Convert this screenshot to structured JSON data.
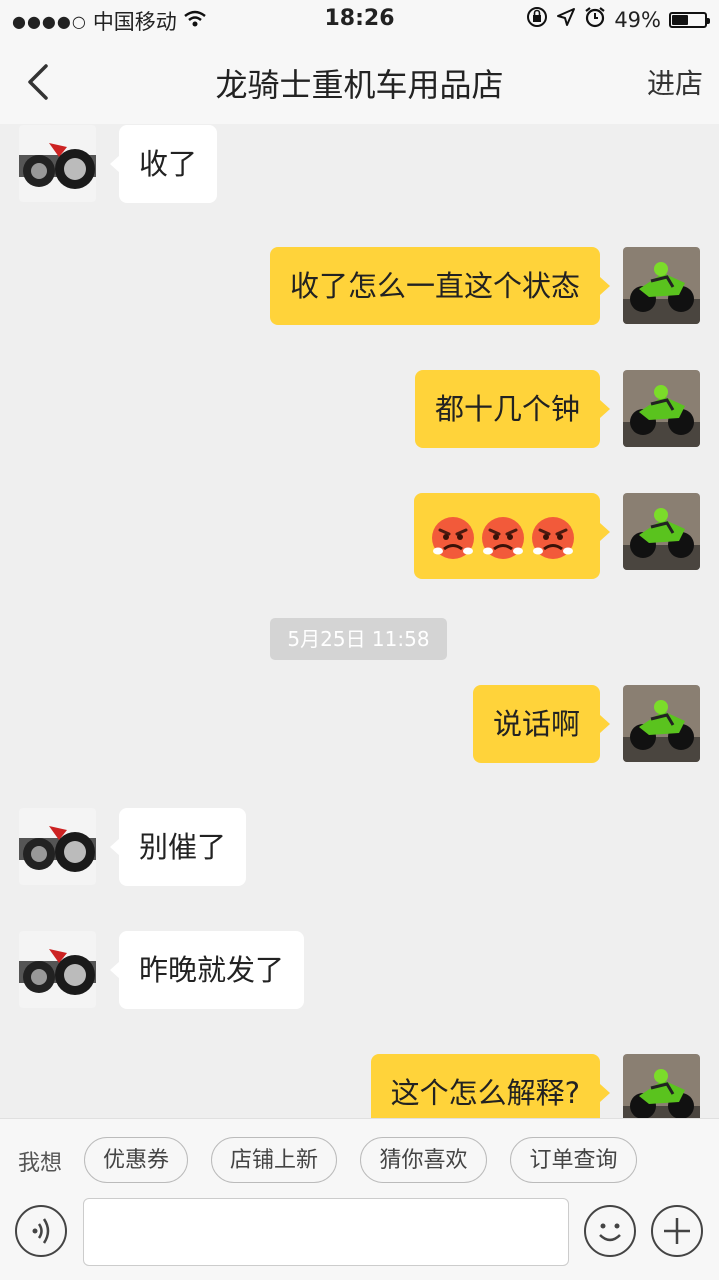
{
  "status_bar": {
    "carrier": "中国移动",
    "time": "18:26",
    "battery": "49%",
    "battery_level": 0.49
  },
  "nav": {
    "title": "龙骑士重机车用品店",
    "enter_shop": "进店"
  },
  "messages": [
    {
      "side": "in",
      "text": "收了"
    },
    {
      "side": "out",
      "text": "收了怎么一直这个状态"
    },
    {
      "side": "out",
      "text": "都十几个钟"
    },
    {
      "side": "out",
      "emoji": [
        "angry-face",
        "angry-face",
        "angry-face"
      ]
    },
    {
      "side": "out",
      "text": "说话啊"
    },
    {
      "side": "in",
      "text": "别催了"
    },
    {
      "side": "in",
      "text": "昨晚就发了"
    },
    {
      "side": "out",
      "text": "这个怎么解释?"
    }
  ],
  "timestamp": "5月25日 11:58",
  "quick_bar": {
    "label": "我想",
    "chips": [
      "优惠券",
      "店铺上新",
      "猜你喜欢",
      "订单查询"
    ]
  },
  "input": {
    "placeholder": ""
  },
  "colors": {
    "outgoing_bubble": "#ffd33a",
    "incoming_bubble": "#ffffff",
    "background": "#efefef"
  }
}
